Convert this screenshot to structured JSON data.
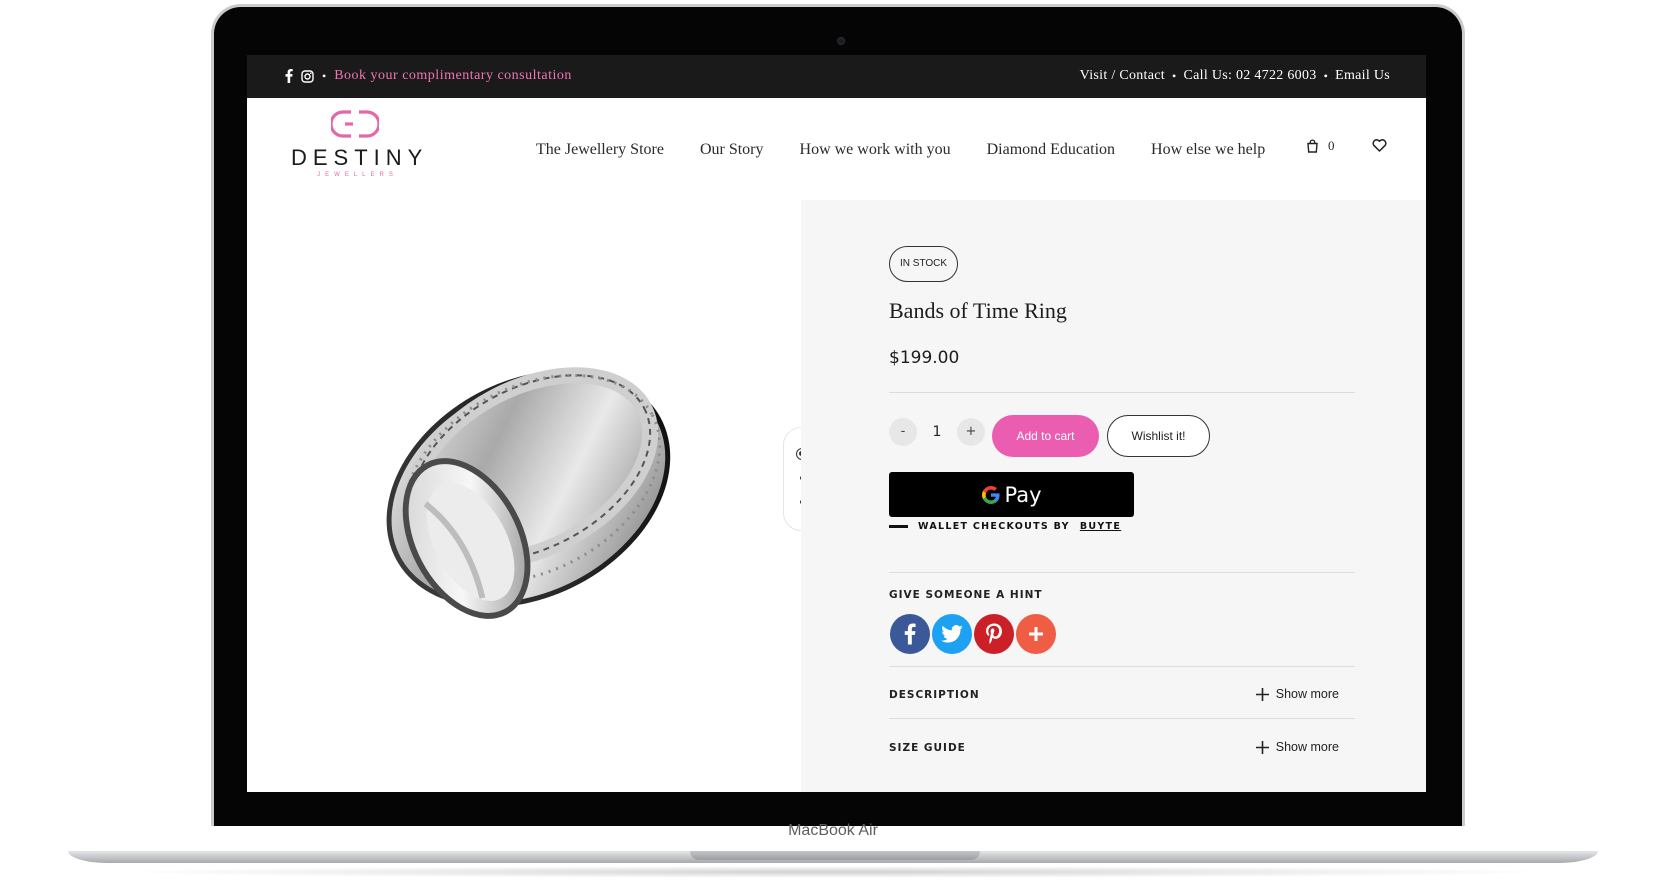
{
  "device": {
    "label": "MacBook Air"
  },
  "topbar": {
    "icons": [
      "facebook-icon",
      "instagram-icon"
    ],
    "separator": "•",
    "consultation_link": "Book your complimentary consultation",
    "links": [
      "Visit / Contact",
      "Call Us: 02 4722 6003",
      "Email Us"
    ]
  },
  "header": {
    "logo": {
      "word": "DESTINY",
      "sub": "JEWELLERS"
    },
    "nav": [
      "The Jewellery Store",
      "Our Story",
      "How we work with you",
      "Diamond Education",
      "How else we help"
    ],
    "cart_count": "0"
  },
  "product": {
    "stock_badge": "IN STOCK",
    "title": "Bands of Time Ring",
    "price": "$199.00",
    "quantity": "1",
    "qty_minus": "-",
    "qty_plus": "+",
    "add_to_cart": "Add to cart",
    "wishlist": "Wishlist it!",
    "gpay_label": "Pay",
    "wallet_text": "WALLET CHECKOUTS BY",
    "wallet_brand": "BUYTE",
    "hint_label": "GIVE SOMEONE A HINT",
    "share": [
      "facebook-icon",
      "twitter-icon",
      "pinterest-icon",
      "plus-icon"
    ],
    "accordions": [
      {
        "title": "DESCRIPTION",
        "toggle": "Show more"
      },
      {
        "title": "SIZE GUIDE",
        "toggle": "Show more"
      }
    ],
    "gallery_slides": 3,
    "active_slide": 1
  },
  "colors": {
    "accent_pink": "#ea5db0",
    "topbar_bg": "#1a1a1a",
    "panel_bg": "#f6f6f6",
    "facebook": "#3b5998",
    "twitter": "#1da1f2",
    "pinterest": "#cb2027",
    "share_more": "#f05d45"
  }
}
